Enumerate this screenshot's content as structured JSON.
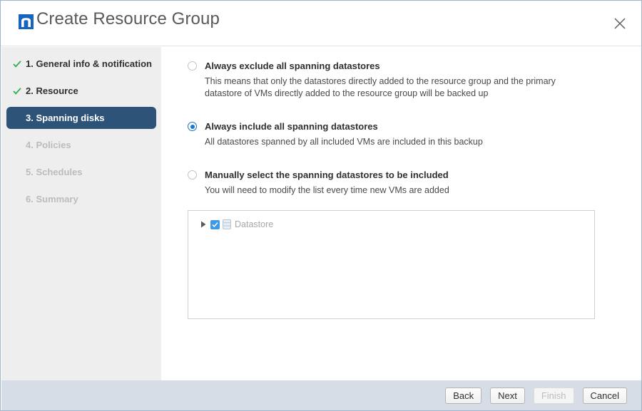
{
  "window": {
    "title": "Create Resource Group",
    "logo_icon": "netapp-logo-icon",
    "close_icon": "close-icon"
  },
  "sidebar": {
    "items": [
      {
        "label": "1. General info & notification",
        "state": "done"
      },
      {
        "label": "2. Resource",
        "state": "done"
      },
      {
        "label": "3. Spanning disks",
        "state": "active"
      },
      {
        "label": "4. Policies",
        "state": "disabled"
      },
      {
        "label": "5. Schedules",
        "state": "disabled"
      },
      {
        "label": "6. Summary",
        "state": "disabled"
      }
    ]
  },
  "main": {
    "options": [
      {
        "label": "Always exclude all spanning datastores",
        "description": "This means that only the datastores directly added to the resource group and the primary datastore of VMs directly added to the resource group will be backed up",
        "selected": false
      },
      {
        "label": "Always include all spanning datastores",
        "description": "All datastores spanned by all included VMs are included in this backup",
        "selected": true
      },
      {
        "label": "Manually select the spanning datastores to be included",
        "description": "You will need to modify the list every time new VMs are added",
        "selected": false
      }
    ],
    "tree": {
      "rows": [
        {
          "label": "Datastore",
          "checked": true,
          "expanded": false,
          "expand_icon": "chevron-right-icon",
          "item_icon": "datastore-icon"
        }
      ]
    }
  },
  "footer": {
    "buttons": [
      {
        "label": "Back",
        "disabled": false
      },
      {
        "label": "Next",
        "disabled": false
      },
      {
        "label": "Finish",
        "disabled": true
      },
      {
        "label": "Cancel",
        "disabled": false
      }
    ]
  },
  "colors": {
    "accent_blue": "#1277d3",
    "active_nav": "#2d5379",
    "check_green": "#2eaf55",
    "footer_bg": "#d7dde6",
    "sidebar_bg": "#eeeeee",
    "logo_blue": "#1564c0"
  }
}
